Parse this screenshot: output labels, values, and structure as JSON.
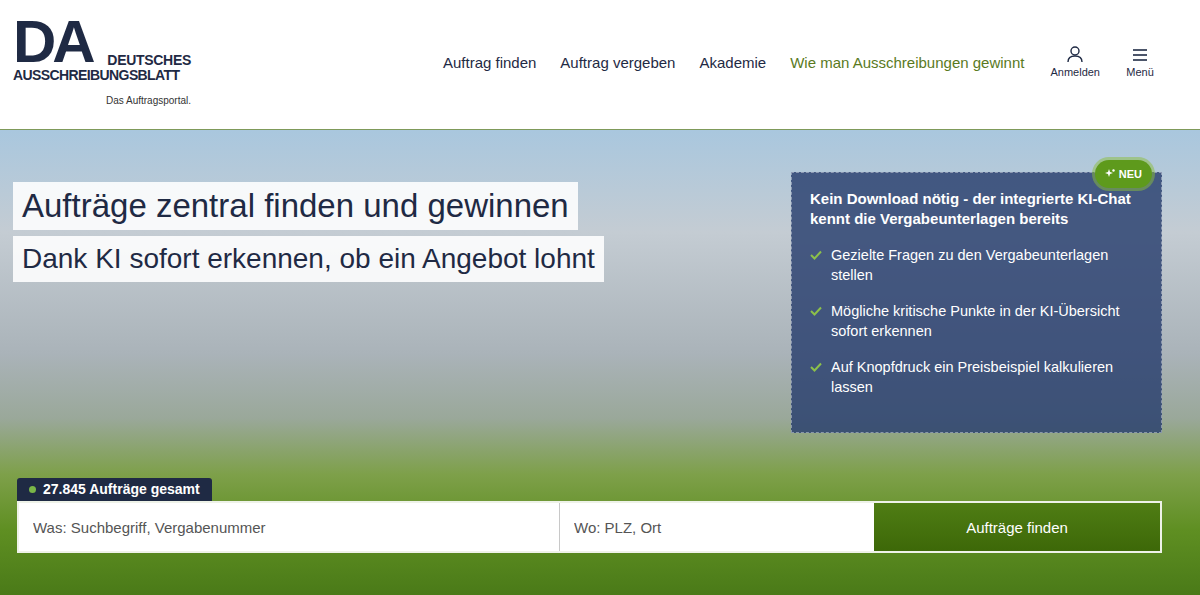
{
  "header": {
    "logo": {
      "mark": "DA",
      "line1": "DEUTSCHES",
      "line2": "AUSSCHREIBUNGSBLATT",
      "tagline": "Das Auftragsportal."
    },
    "nav": [
      {
        "label": "Auftrag finden",
        "kind": "link"
      },
      {
        "label": "Auftrag vergeben",
        "kind": "link"
      },
      {
        "label": "Akademie",
        "kind": "link"
      },
      {
        "label": "Wie man Ausschreibungen gewinnt",
        "kind": "promo"
      }
    ],
    "actions": [
      {
        "label": "Anmelden"
      },
      {
        "label": "Menü"
      }
    ]
  },
  "hero": {
    "headline": "Aufträge zentral finden und gewinnen",
    "subheadline": "Dank KI sofort erkennen, ob ein Angebot lohnt",
    "card": {
      "badge": "NEU",
      "title": "Kein Download nötig - der integrierte KI-Chat kennt die Vergabeunterlagen bereits",
      "items": [
        "Gezielte Fragen zu den Vergabeunterlagen stellen",
        "Mögliche kritische Punkte in der KI-Übersicht sofort erkennen",
        "Auf Knopfdruck ein Preisbeispiel kalkulieren lassen"
      ]
    }
  },
  "search": {
    "count": "27.845 Aufträge gesamt",
    "what_placeholder": "Was: Suchbegriff, Vergabenummer",
    "where_placeholder": "Wo: PLZ, Ort",
    "button": "Aufträge finden"
  }
}
